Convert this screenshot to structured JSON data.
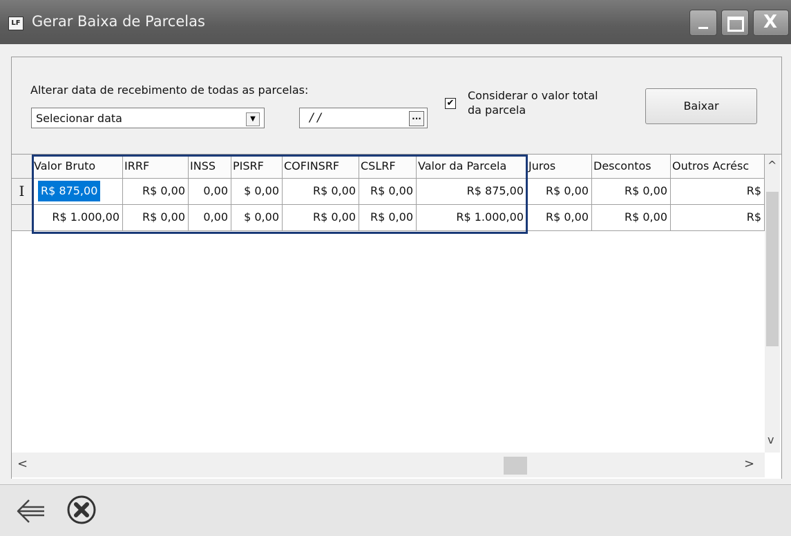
{
  "window": {
    "title": "Gerar Baixa de Parcelas",
    "app_icon": "LF",
    "controls": {
      "close": "X"
    }
  },
  "form": {
    "alter_label": "Alterar data de recebimento de todas as parcelas:",
    "date_select": {
      "value": "Selecionar data",
      "arrow": "▼"
    },
    "date_field": {
      "value": "/ /",
      "button": "..."
    },
    "consider_checkbox": {
      "checked": true,
      "mark": "✔",
      "label": "Considerar o valor total da parcela"
    },
    "baixar_label": "Baixar"
  },
  "grid": {
    "columns": [
      "Valor Bruto",
      "IRRF",
      "INSS",
      "PISRF",
      "COFINSRF",
      "CSLRF",
      "Valor da Parcela",
      "Juros",
      "Descontos",
      "Outros Acrésc"
    ],
    "rows": [
      {
        "row_marker": "I",
        "cells": [
          "R$ 875,00",
          "R$ 0,00",
          "0,00",
          "$ 0,00",
          "R$ 0,00",
          "R$ 0,00",
          "R$ 875,00",
          "R$ 0,00",
          "R$ 0,00",
          "R$"
        ]
      },
      {
        "row_marker": "",
        "cells": [
          "R$ 1.000,00",
          "R$ 0,00",
          "0,00",
          "$ 0,00",
          "R$ 0,00",
          "R$ 0,00",
          "R$ 1.000,00",
          "R$ 0,00",
          "R$ 0,00",
          "R$"
        ]
      }
    ],
    "selected_cell": {
      "row": 0,
      "column": 0
    },
    "scroll": {
      "up": "^",
      "down": "v",
      "left": "<",
      "right": ">"
    }
  },
  "toolbar": {
    "icons": [
      "back-arrow-icon",
      "cancel-circle-icon"
    ]
  },
  "colors": {
    "selection": "#0078d7",
    "highlight_border": "#1a3a78",
    "titlebar": "#5c5c5c"
  }
}
